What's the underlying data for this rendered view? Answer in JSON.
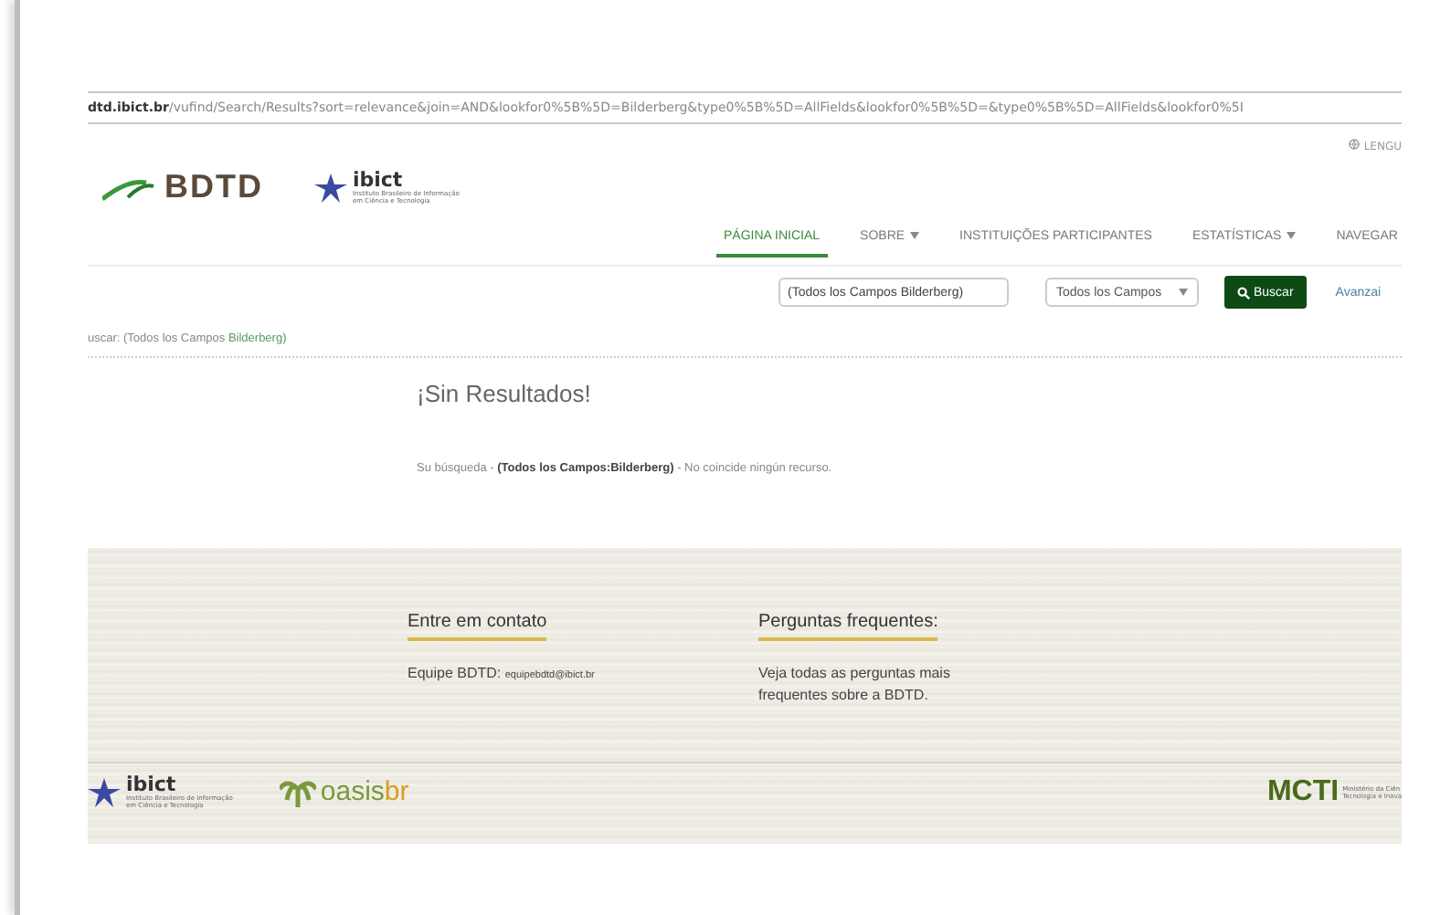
{
  "url": {
    "host": "dtd.ibict.br",
    "path": "/vufind/Search/Results?sort=relevance&join=AND&lookfor0%5B%5D=Bilderberg&type0%5B%5D=AllFields&lookfor0%5B%5D=&type0%5B%5D=AllFields&lookfor0%5I"
  },
  "header": {
    "brand": "BDTD",
    "partner": {
      "name": "ibict",
      "subtitle": [
        "Instituto Brasileiro de Informação",
        "em Ciência e Tecnologia"
      ]
    },
    "language": "LENGU",
    "nav": [
      {
        "label": "PÁGINA INICIAL",
        "selected": true,
        "dropdown": false
      },
      {
        "label": "SOBRE",
        "selected": false,
        "dropdown": true
      },
      {
        "label": "INSTITUIÇÕES PARTICIPANTES",
        "selected": false,
        "dropdown": false
      },
      {
        "label": "ESTATÍSTICAS",
        "selected": false,
        "dropdown": true
      },
      {
        "label": "NAVEGAR",
        "selected": false,
        "dropdown": false
      }
    ]
  },
  "search": {
    "value": "(Todos los Campos Bilderberg)",
    "scope": "Todos los Campos",
    "button": "Buscar",
    "advanced": "Avanzai"
  },
  "breadcrumb": {
    "prefix": "uscar: (Todos los Campos ",
    "query": "Bilderberg)"
  },
  "results": {
    "heading": "¡Sin Resultados!",
    "message": "Su búsqueda - **(Todos los Campos:Bilderberg)** - No coincide ningún recurso."
  },
  "footer": {
    "columns": [
      {
        "heading": "Entre em contato",
        "text": "Equipe BDTD:",
        "email": "equipebdtd@ibict.br"
      },
      {
        "heading": "Perguntas frequentes:",
        "text": "Veja todas as perguntas mais frequentes sobre a BDTD."
      }
    ],
    "logos": {
      "ibict": {
        "name": "ibict",
        "subtitle": [
          "Instituto Brasileiro de Informação",
          "em Ciência e Tecnologia"
        ]
      },
      "oasis": {
        "first": "oasis",
        "second": "br"
      },
      "mcti": {
        "name": "MCTI",
        "subtitle": [
          "Ministério da Ciên",
          "Tecnologia e Inova"
        ]
      }
    }
  }
}
